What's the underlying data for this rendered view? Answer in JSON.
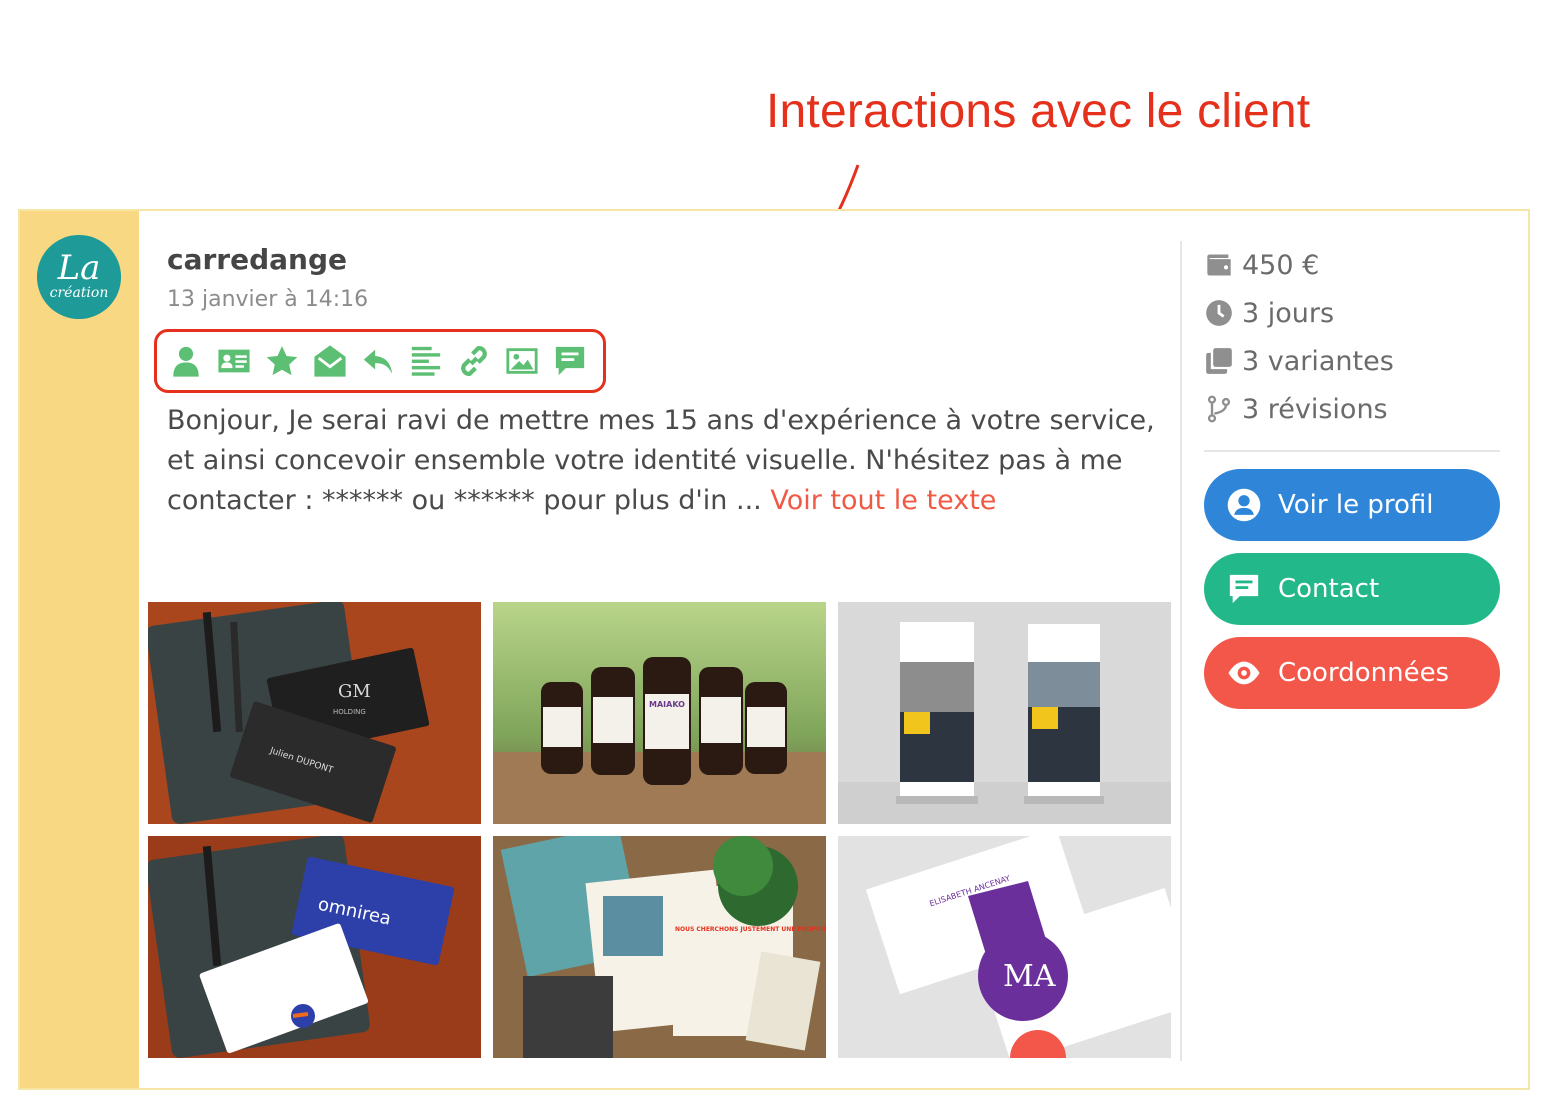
{
  "annotation": {
    "title": "Interactions avec le client",
    "color": "#e5301c"
  },
  "post": {
    "username": "carredange",
    "date": "13 janvier à 14:16",
    "message": "Bonjour, Je serai ravi de mettre mes 15 ans d'expérience à votre service, et ainsi concevoir ensemble votre identité visuelle. N'hésitez pas à me contacter : ****** ou ****** pour plus d'in ... ",
    "more_link": "Voir tout le texte",
    "avatar_text": "La création"
  },
  "interaction_icons": [
    "user-icon",
    "id-card-icon",
    "star-icon",
    "envelope-open-icon",
    "reply-icon",
    "align-left-icon",
    "link-icon",
    "image-icon",
    "comment-icon"
  ],
  "gallery": [
    {
      "name": "business-card-gm-holding",
      "card_title": "GM",
      "card_sub": "HOLDING",
      "person": "Julien DUPONT"
    },
    {
      "name": "product-bottles-maiako",
      "label": "MAIAKO"
    },
    {
      "name": "rollup-banners"
    },
    {
      "name": "business-card-omnirea",
      "label": "omnirea"
    },
    {
      "name": "real-estate-flyers",
      "label": "NOUS CHERCHONS JUSTEMENT UNE PROPRIÉTÉ COMME LA VÔTRE !"
    },
    {
      "name": "business-card-nouvelle-adresse",
      "label": "ELISABETH ANCENAY",
      "logo": "MA"
    }
  ],
  "stats": {
    "price": "450 €",
    "duration": "3 jours",
    "variants": "3 variantes",
    "revisions": "3 révisions"
  },
  "actions": {
    "profile": "Voir le profil",
    "contact": "Contact",
    "coords": "Coordonnées"
  },
  "colors": {
    "stripe": "#f8d882",
    "icon_green": "#5cbf73",
    "profile_btn": "#2f86d9",
    "contact_btn": "#22b889",
    "coords_btn": "#f3574a",
    "link_red": "#f05a44"
  }
}
